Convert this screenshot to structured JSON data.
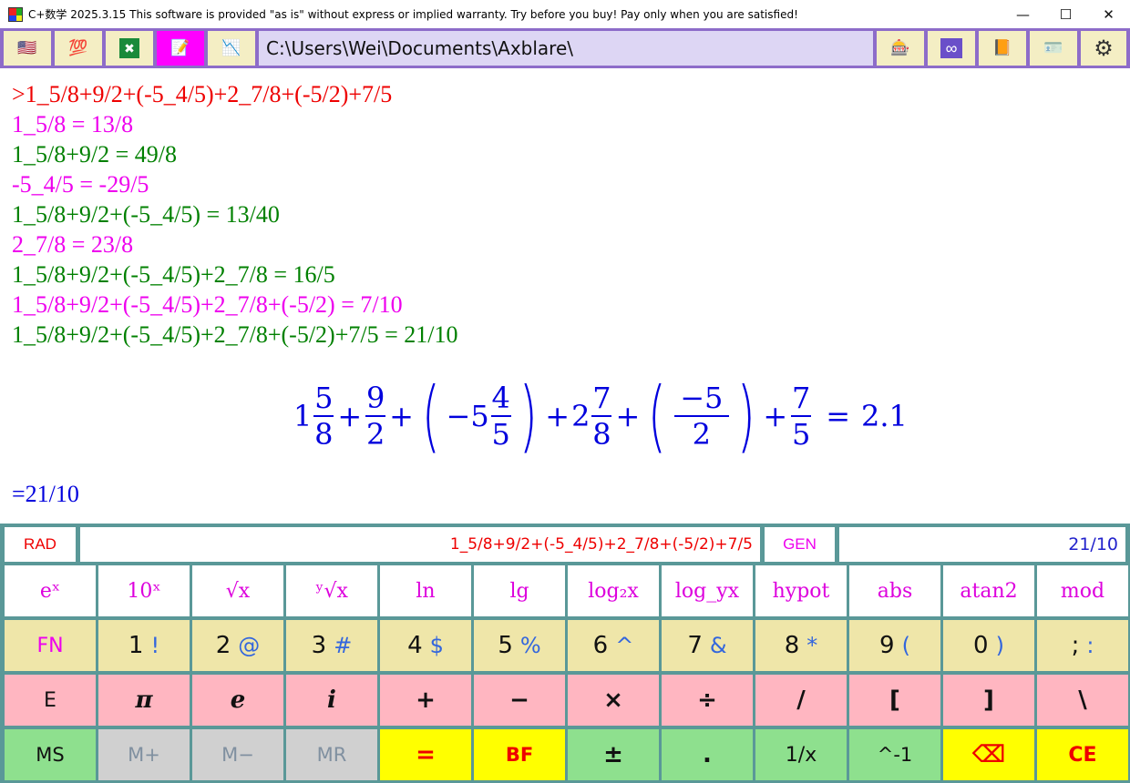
{
  "window": {
    "title": "C+数学 2025.3.15 This software is provided \"as is\" without express or implied warranty. Try before you buy! Pay only when you are satisfied!",
    "minimize": "—",
    "maximize": "☐",
    "close": "✕"
  },
  "toolbar": {
    "left_buttons": [
      {
        "name": "us-flag-icon",
        "glyph": "🇺🇸"
      },
      {
        "name": "hundred-points-icon",
        "glyph": "💯"
      },
      {
        "name": "excel-icon",
        "glyph": "✖"
      },
      {
        "name": "notepad-icon",
        "glyph": "📝"
      },
      {
        "name": "chart-icon",
        "glyph": "📉"
      }
    ],
    "path": "C:\\Users\\Wei\\Documents\\Axblare\\",
    "right_buttons": [
      {
        "name": "slot-machine-icon",
        "glyph": "🎰"
      },
      {
        "name": "infinity-icon",
        "glyph": "∞"
      },
      {
        "name": "book-icon",
        "glyph": "📙"
      },
      {
        "name": "id-card-icon",
        "glyph": "🪪"
      },
      {
        "name": "gear-icon",
        "glyph": "⚙"
      }
    ],
    "colors": {
      "bar": "#8d6cc9",
      "active": "#ff00ff",
      "path_bg": "#ddd6f4"
    }
  },
  "output": {
    "lines": [
      {
        "text": ">1_5/8+9/2+(-5_4/5)+2_7/8+(-5/2)+7/5",
        "color": "red"
      },
      {
        "text": "1_5/8 = 13/8",
        "color": "magenta"
      },
      {
        "text": "1_5/8+9/2 = 49/8",
        "color": "green"
      },
      {
        "text": "-5_4/5 = -29/5",
        "color": "magenta"
      },
      {
        "text": "1_5/8+9/2+(-5_4/5) = 13/40",
        "color": "green"
      },
      {
        "text": "2_7/8 = 23/8",
        "color": "magenta"
      },
      {
        "text": "1_5/8+9/2+(-5_4/5)+2_7/8 = 16/5",
        "color": "green"
      },
      {
        "text": "1_5/8+9/2+(-5_4/5)+2_7/8+(-5/2) = 7/10",
        "color": "magenta"
      },
      {
        "text": "1_5/8+9/2+(-5_4/5)+2_7/8+(-5/2)+7/5 = 21/10",
        "color": "green"
      }
    ],
    "formula": {
      "t1_whole": "1",
      "t1_num": "5",
      "t1_den": "8",
      "plus": "+",
      "t2_num": "9",
      "t2_den": "2",
      "t3_sign": "−5",
      "t3_num": "4",
      "t3_den": "5",
      "t4_whole": "2",
      "t4_num": "7",
      "t4_den": "8",
      "t5_num": "−5",
      "t5_den": "2",
      "t6_num": "7",
      "t6_den": "5",
      "lparen": "(",
      "rparen": ")",
      "equals": "=",
      "result": "2.1"
    },
    "result_line": "=21/10"
  },
  "status": {
    "mode": "RAD",
    "expression": "1_5/8+9/2+(-5_4/5)+2_7/8+(-5/2)+7/5",
    "format": "GEN",
    "result": "21/10"
  },
  "keys": {
    "functions": [
      "eˣ",
      "10ˣ",
      "√x",
      "ʸ√x",
      "ln",
      "lg",
      "log₂x",
      "log_yx",
      "hypot",
      "abs",
      "atan2",
      "mod"
    ],
    "numbers": [
      {
        "main": "FN",
        "shift": ""
      },
      {
        "main": "1",
        "shift": "!"
      },
      {
        "main": "2",
        "shift": "@"
      },
      {
        "main": "3",
        "shift": "#"
      },
      {
        "main": "4",
        "shift": "$"
      },
      {
        "main": "5",
        "shift": "%"
      },
      {
        "main": "6",
        "shift": "^"
      },
      {
        "main": "7",
        "shift": "&"
      },
      {
        "main": "8",
        "shift": "*"
      },
      {
        "main": "9",
        "shift": "("
      },
      {
        "main": "0",
        "shift": ")"
      },
      {
        "main": ";",
        "shift": ":"
      }
    ],
    "operators": [
      "E",
      "π",
      "e",
      "i",
      "+",
      "−",
      "×",
      "÷",
      "/",
      "[",
      "]",
      "\\"
    ],
    "bottom": [
      "MS",
      "M+",
      "M−",
      "MR",
      "=",
      "BF",
      "±",
      ".",
      "1/x",
      "^-1",
      "⌫",
      "CE"
    ]
  }
}
